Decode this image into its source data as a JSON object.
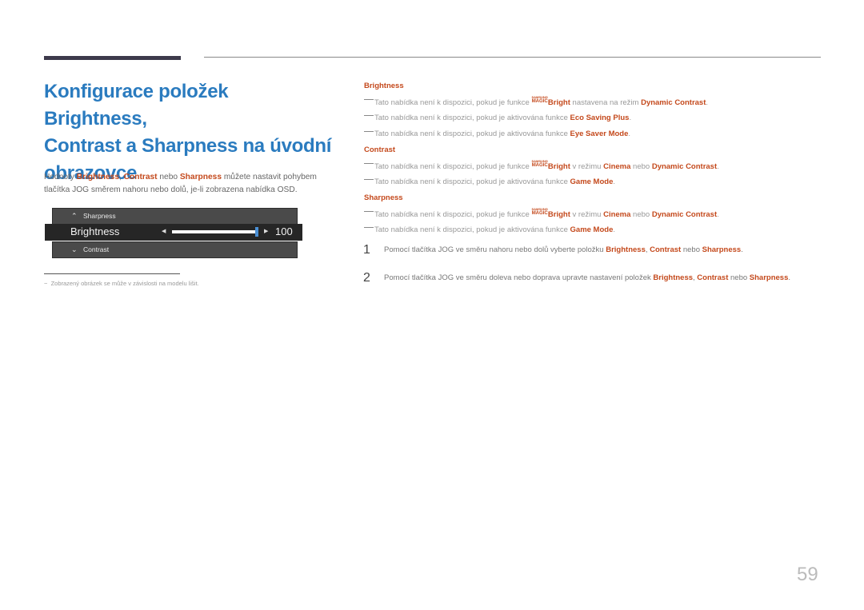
{
  "page_title_lines": [
    "Konfigurace položek Brightness,",
    "Contrast a Sharpness na úvodní",
    "obrazovce"
  ],
  "intro": {
    "p1": "Hodnoty ",
    "b1": "Brightness",
    "p2": ", ",
    "b2": "Contrast",
    "p3": " nebo ",
    "b3": "Sharpness",
    "p4": " můžete nastavit pohybem tlačítka JOG směrem nahoru nebo dolů, je-li zobrazena nabídka OSD."
  },
  "osd": {
    "top_label": "Sharpness",
    "top_icon": "chevron-up-icon",
    "main_label": "Brightness",
    "value": "100",
    "slider_fraction": 1.0,
    "bottom_label": "Contrast",
    "bottom_icon": "chevron-down-icon",
    "accent_color": "#4a90d6"
  },
  "footnote": "Zobrazený obrázek se může v závislosti na modelu lišit.",
  "sections": {
    "brightness": {
      "heading": "Brightness",
      "n1a": "Tato nabídka není k dispozici, pokud je funkce ",
      "n1b": " nastavena na režim ",
      "n1c": "Dynamic Contrast",
      "n2a": "Tato nabídka není k dispozici, pokud je aktivována funkce ",
      "n2b": "Eco Saving Plus",
      "n3a": "Tato nabídka není k dispozici, pokud je aktivována funkce ",
      "n3b": "Eye Saver Mode"
    },
    "contrast": {
      "heading": "Contrast",
      "n1a": "Tato nabídka není k dispozici, pokud je funkce ",
      "n1b": " v režimu ",
      "n1c": "Cinema",
      "n1d": " nebo ",
      "n1e": "Dynamic Contrast",
      "n2a": "Tato nabídka není k dispozici, pokud je aktivována funkce ",
      "n2b": "Game Mode"
    },
    "sharpness": {
      "heading": "Sharpness",
      "n1a": "Tato nabídka není k dispozici, pokud je funkce ",
      "n1b": " v režimu ",
      "n1c": "Cinema",
      "n1d": " nebo ",
      "n1e": "Dynamic Contrast",
      "n2a": "Tato nabídka není k dispozici, pokud je aktivována funkce ",
      "n2b": "Game Mode"
    }
  },
  "magic_bright": {
    "samsung": "SAMSUNG",
    "magic": "MAGIC",
    "bright": "Bright"
  },
  "steps": [
    {
      "num": "1",
      "t1": "Pomocí tlačítka JOG ve směru nahoru nebo dolů vyberte položku ",
      "b1": "Brightness",
      "t2": ", ",
      "b2": "Contrast",
      "t3": " nebo ",
      "b3": "Sharpness",
      "t4": "."
    },
    {
      "num": "2",
      "t1": "Pomocí tlačítka JOG ve směru doleva nebo doprava upravte nastavení položek ",
      "b1": "Brightness",
      "t2": ", ",
      "b2": "Contrast",
      "t3": " nebo ",
      "b3": "Sharpness",
      "t4": "."
    }
  ],
  "period": ".",
  "page_number": "59",
  "colors": {
    "title": "#2a7bbf",
    "highlight": "#c4491c"
  }
}
